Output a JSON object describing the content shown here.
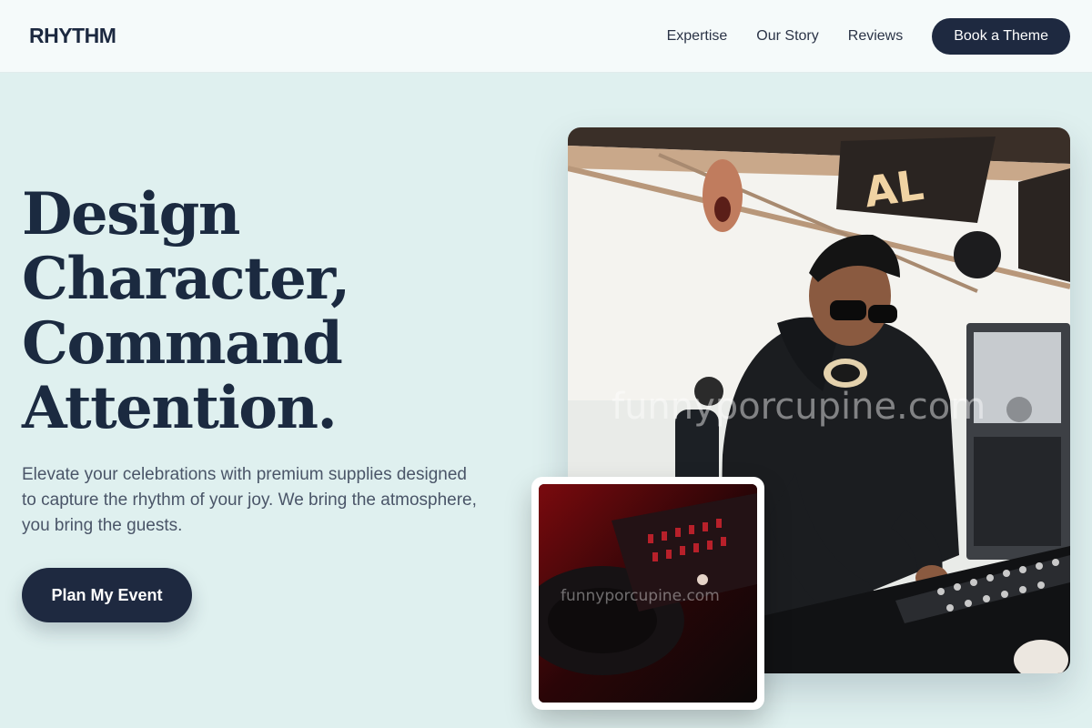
{
  "header": {
    "logo": "RHYTHM",
    "nav": [
      {
        "label": "Expertise"
      },
      {
        "label": "Our Story"
      },
      {
        "label": "Reviews"
      }
    ],
    "cta_label": "Book a Theme"
  },
  "hero": {
    "headline_lines": [
      "Design",
      "Character,",
      "Command",
      "Attention."
    ],
    "subtext": "Elevate your celebrations with premium supplies designed to capture the rhythm of your joy. We bring the atmosphere, you bring the guests.",
    "cta_label": "Plan My Event"
  },
  "images": {
    "main_watermark": "funnyporcupine.com",
    "inset_watermark": "funnyporcupine.com"
  },
  "colors": {
    "page_bg": "#dff0ef",
    "header_bg": "#f5fafa",
    "navy": "#1e2940",
    "text_muted": "#4a5568"
  }
}
